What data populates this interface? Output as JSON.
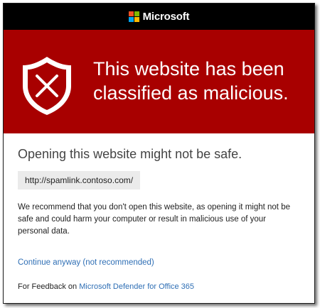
{
  "header": {
    "brand_name": "Microsoft"
  },
  "colors": {
    "logo_red": "#f25022",
    "logo_green": "#7fba00",
    "logo_blue": "#00a4ef",
    "logo_yellow": "#ffb900",
    "banner": "#a80000",
    "link": "#2f6fb5"
  },
  "banner": {
    "icon": "shield-x-icon",
    "headline": "This website has been classified as malicious."
  },
  "main": {
    "subtitle": "Opening this website might not be safe.",
    "url": "http://spamlink.contoso.com/",
    "message": "We recommend that you don't open this website, as opening it might not be safe and could harm your computer or result in malicious use of your personal data.",
    "continue_link": "Continue anyway (not recommended)"
  },
  "footer": {
    "feedback_prefix": "For Feedback on",
    "feedback_link": "Microsoft Defender for Office 365"
  }
}
